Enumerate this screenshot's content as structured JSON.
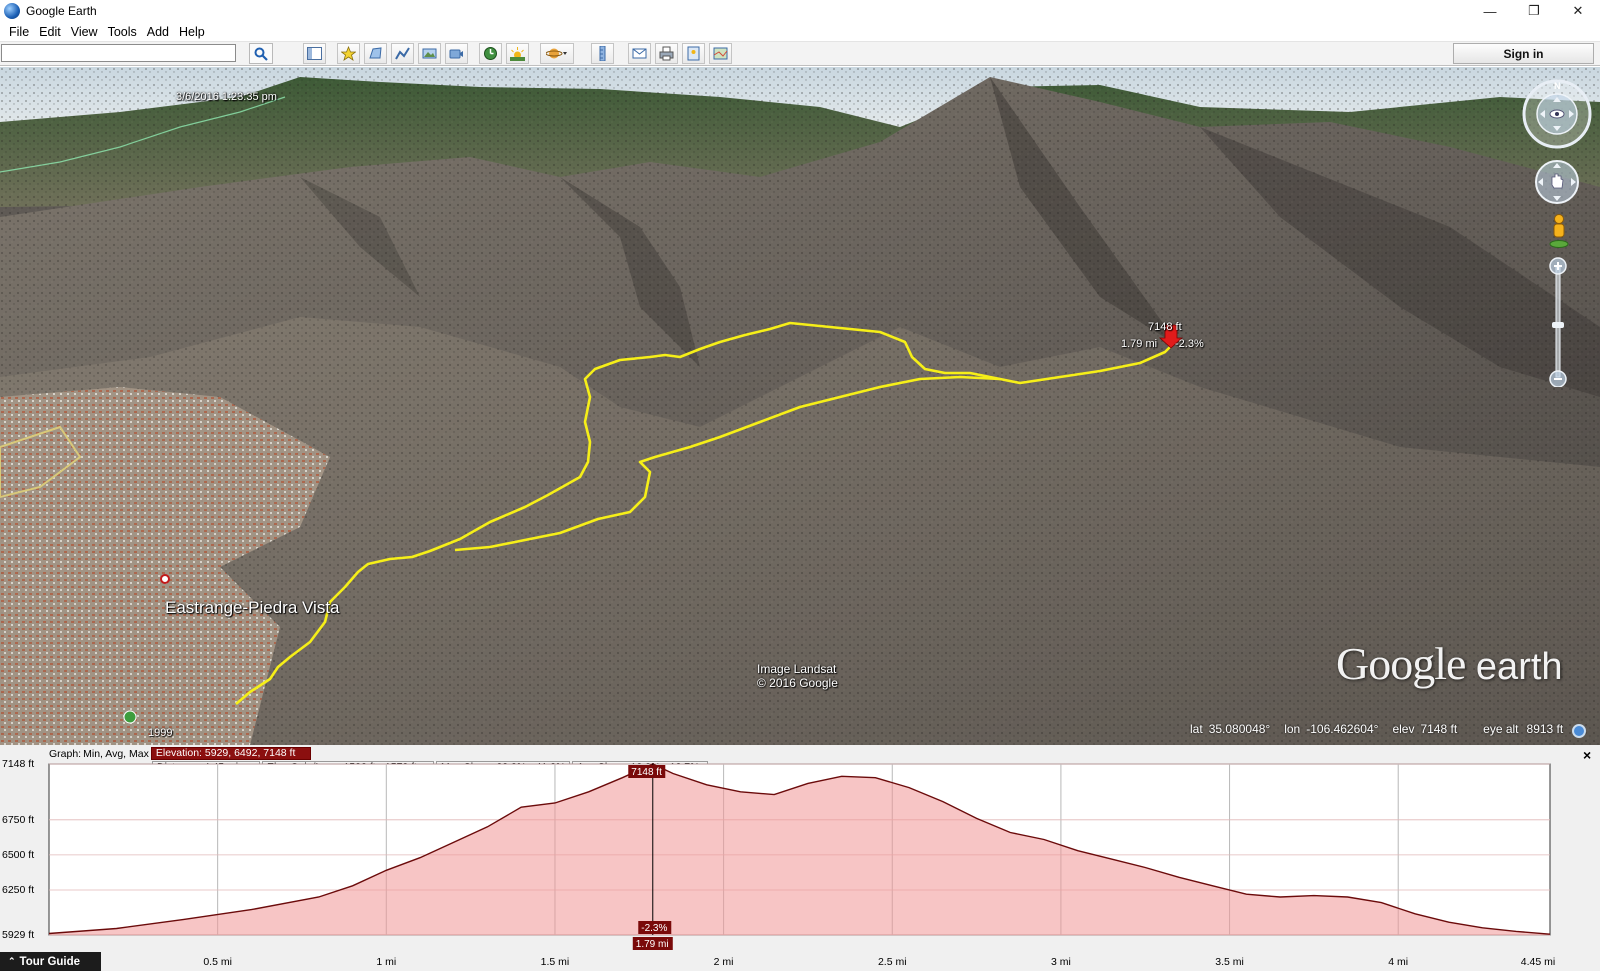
{
  "window": {
    "title": "Google Earth",
    "minimize": "—",
    "restore": "❐",
    "close": "✕"
  },
  "menu": [
    "File",
    "Edit",
    "View",
    "Tools",
    "Add",
    "Help"
  ],
  "toolbar": {
    "search_value": "",
    "sign_in_label": "Sign in"
  },
  "map": {
    "date_label": "3/6/2016   1:23:35 pm",
    "place_label": "Eastrange-Piedra Vista",
    "credit_line1": "Image Landsat",
    "credit_line2": "© 2016 Google",
    "marker_elevation": "7148 ft",
    "marker_distance": "1.79 mi",
    "marker_slope": "-2.3%",
    "year_label": "1999",
    "logo_google": "Google",
    "logo_earth": "earth",
    "compass_letter": "N"
  },
  "statusbar": {
    "lat_label": "lat",
    "lat_value": "35.080048°",
    "lon_label": "lon",
    "lon_value": "-106.462604°",
    "elev_label": "elev",
    "elev_value": "7148 ft",
    "eye_alt_label": "eye alt",
    "eye_alt_value": "8913 ft"
  },
  "profile": {
    "graph_label": "Graph:",
    "graph_value": "Min, Avg, Max",
    "elevation_text": "Elevation: 5929, 6492, 7148 ft",
    "range_label": "Range Totals:",
    "distance_text": "Distance: 4.45 mi",
    "gain_loss_text": "Elev Gain/Loss: 1582 ft, -1578 ft",
    "max_slope_text": "Max Slope: 38.3%, -41.2%",
    "avg_slope_text": "Avg Slope: 12.8%, -12.7%",
    "close_label": "×",
    "cursor_elevation": "7148 ft",
    "cursor_slope": "-2.3%",
    "cursor_distance": "1.79 mi",
    "cursor_x_mi": 1.79,
    "tour_guide_label": "Tour Guide"
  },
  "chart_data": {
    "type": "area",
    "xlabel": "",
    "ylabel": "",
    "xlim": [
      0,
      4.45
    ],
    "ylim": [
      5929,
      7148
    ],
    "x_ticks": [
      "0.5 mi",
      "1 mi",
      "1.5 mi",
      "2 mi",
      "2.5 mi",
      "3 mi",
      "3.5 mi",
      "4 mi",
      "4.45 mi"
    ],
    "x_tick_values": [
      0.5,
      1,
      1.5,
      2,
      2.5,
      3,
      3.5,
      4,
      4.45
    ],
    "y_ticks": [
      "7148 ft",
      "6750 ft",
      "6500 ft",
      "6250 ft",
      "5929 ft"
    ],
    "y_tick_values": [
      7148,
      6750,
      6500,
      6250,
      5929
    ],
    "series": [
      {
        "x": [
          0,
          0.2,
          0.4,
          0.6,
          0.8,
          0.9,
          1.0,
          1.1,
          1.2,
          1.3,
          1.4,
          1.5,
          1.6,
          1.7,
          1.79,
          1.85,
          1.95,
          2.05,
          2.15,
          2.25,
          2.35,
          2.45,
          2.55,
          2.65,
          2.75,
          2.85,
          2.95,
          3.05,
          3.15,
          3.25,
          3.35,
          3.45,
          3.55,
          3.65,
          3.75,
          3.85,
          3.95,
          4.05,
          4.15,
          4.25,
          4.35,
          4.45
        ],
        "y": [
          5940,
          5975,
          6040,
          6110,
          6200,
          6280,
          6390,
          6480,
          6590,
          6700,
          6840,
          6870,
          6950,
          7050,
          7148,
          7080,
          7000,
          6950,
          6930,
          7010,
          7060,
          7050,
          6980,
          6880,
          6760,
          6660,
          6610,
          6530,
          6470,
          6410,
          6340,
          6280,
          6220,
          6200,
          6210,
          6200,
          6160,
          6080,
          6020,
          5980,
          5955,
          5935
        ]
      }
    ]
  }
}
